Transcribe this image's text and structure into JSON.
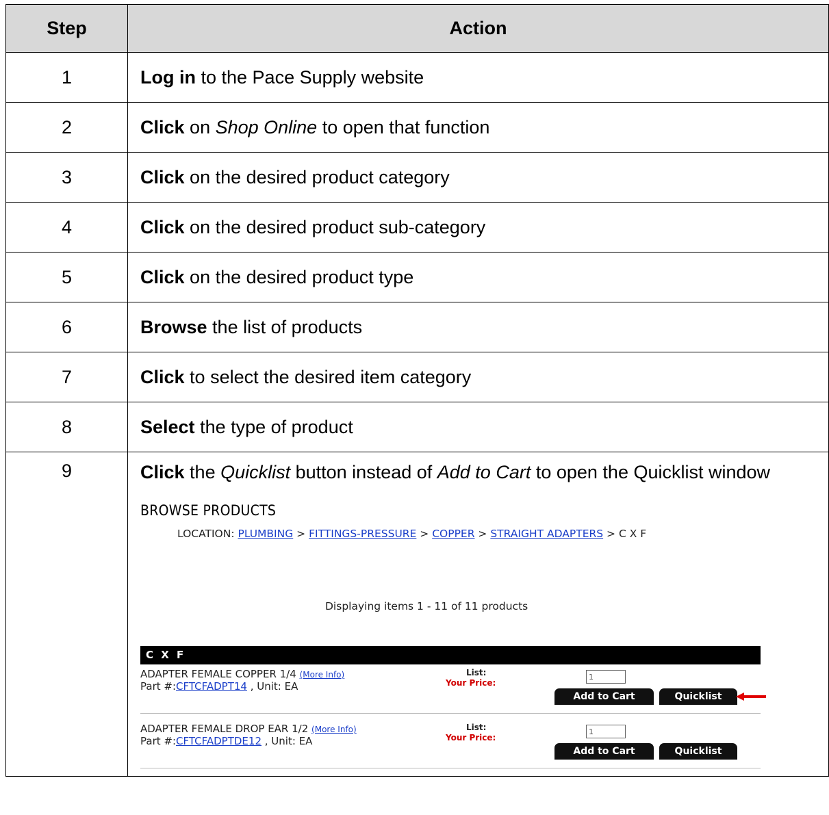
{
  "table": {
    "header_step": "Step",
    "header_action": "Action"
  },
  "steps": [
    {
      "num": "1",
      "verb": "Log in",
      "rest": " to the Pace Supply website"
    },
    {
      "num": "2",
      "verb": "Click",
      "mid": " on ",
      "italic": "Shop Online",
      "rest": " to open that function"
    },
    {
      "num": "3",
      "verb": "Click",
      "rest": " on the desired product category"
    },
    {
      "num": "4",
      "verb": "Click",
      "rest": " on the desired product sub-category"
    },
    {
      "num": "5",
      "verb": "Click",
      "rest": " on the desired product type"
    },
    {
      "num": "6",
      "verb": "Browse",
      "rest": " the list of products"
    },
    {
      "num": "7",
      "verb": "Click",
      "rest": " to select the desired item category"
    },
    {
      "num": "8",
      "verb": "Select",
      "rest": " the type of product"
    }
  ],
  "step9": {
    "num": "9",
    "verb": "Click",
    "t1": " the ",
    "i1": "Quicklist",
    "t2": " button instead of ",
    "i2": "Add to Cart",
    "t3": " to open the Quicklist window"
  },
  "browse": {
    "title": "BROWSE PRODUCTS",
    "location_label": "LOCATION:",
    "crumbs": [
      "PLUMBING",
      "FITTINGS-PRESSURE",
      "COPPER",
      "STRAIGHT ADAPTERS"
    ],
    "crumb_sep": " > ",
    "crumb_last": "C X F",
    "displaying": "Displaying items 1 - 11 of 11 products",
    "category": "C X F",
    "products": [
      {
        "name": "ADAPTER FEMALE COPPER 1/4",
        "more": "(More Info)",
        "part_label": "Part #:",
        "part": "CFTCFADPT14",
        "unit": " , Unit: EA",
        "list": "List:",
        "price": "Your Price:",
        "qty": "1",
        "add": "Add to Cart",
        "quicklist": "Quicklist"
      },
      {
        "name": "ADAPTER FEMALE DROP EAR 1/2",
        "more": "(More Info)",
        "part_label": "Part #:",
        "part": "CFTCFADPTDE12",
        "unit": " , Unit: EA",
        "list": "List:",
        "price": "Your Price:",
        "qty": "1",
        "add": "Add to Cart",
        "quicklist": "Quicklist"
      }
    ],
    "arrow_color": "#e00000"
  }
}
